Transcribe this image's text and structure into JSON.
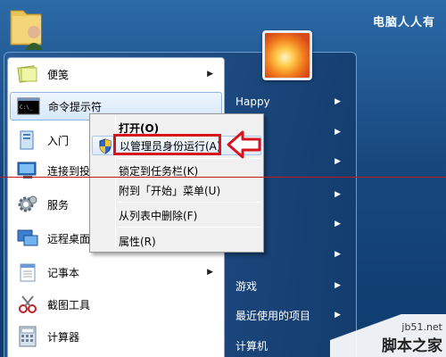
{
  "watermark_top": "电脑人人有",
  "watermark_bottom": {
    "url": "jb51.net",
    "site": "脚本之家"
  },
  "programs": [
    {
      "label": "便笺",
      "icon": "sticky-note-icon",
      "has_arrow": true,
      "highlighted": false
    },
    {
      "label": "命令提示符",
      "icon": "command-prompt-icon",
      "has_arrow": false,
      "highlighted": true
    },
    {
      "label": "入门",
      "icon": "getting-started-icon",
      "has_arrow": false,
      "highlighted": false
    },
    {
      "label": "连接到投影",
      "icon": "projector-icon",
      "has_arrow": false,
      "highlighted": false
    },
    {
      "label": "服务",
      "icon": "services-gear-icon",
      "has_arrow": false,
      "highlighted": false
    },
    {
      "label": "远程桌面连",
      "icon": "remote-desktop-icon",
      "has_arrow": false,
      "highlighted": false
    },
    {
      "label": "记事本",
      "icon": "notepad-icon",
      "has_arrow": true,
      "highlighted": false
    },
    {
      "label": "截图工具",
      "icon": "snipping-tool-icon",
      "has_arrow": false,
      "highlighted": false
    },
    {
      "label": "计算器",
      "icon": "calculator-icon",
      "has_arrow": false,
      "highlighted": false
    }
  ],
  "right_pane": [
    {
      "label": "Happy",
      "has_arrow": true
    },
    {
      "label": "",
      "has_arrow": true
    },
    {
      "label": "",
      "has_arrow": true
    },
    {
      "label": "",
      "has_arrow": true
    },
    {
      "label": "",
      "has_arrow": true
    },
    {
      "label": "",
      "has_arrow": true
    },
    {
      "label": "游戏",
      "has_arrow": true
    },
    {
      "label": "最近使用的项目",
      "has_arrow": true
    },
    {
      "label": "计算机",
      "has_arrow": false
    }
  ],
  "context_menu": [
    {
      "label": "打开(O)",
      "bold": true,
      "selected": false,
      "icon": ""
    },
    {
      "label": "以管理员身份运行(A)",
      "bold": false,
      "selected": true,
      "icon": "uac-shield-icon"
    },
    {
      "label": "锁定到任务栏(K)",
      "bold": false,
      "selected": false,
      "icon": ""
    },
    {
      "label": "附到「开始」菜单(U)",
      "bold": false,
      "selected": false,
      "icon": ""
    },
    {
      "label": "从列表中删除(F)",
      "bold": false,
      "selected": false,
      "icon": ""
    },
    {
      "label": "属性(R)",
      "bold": false,
      "selected": false,
      "icon": ""
    }
  ],
  "colors": {
    "highlight_red": "#d8141d",
    "desktop_blue": "#17487d"
  }
}
